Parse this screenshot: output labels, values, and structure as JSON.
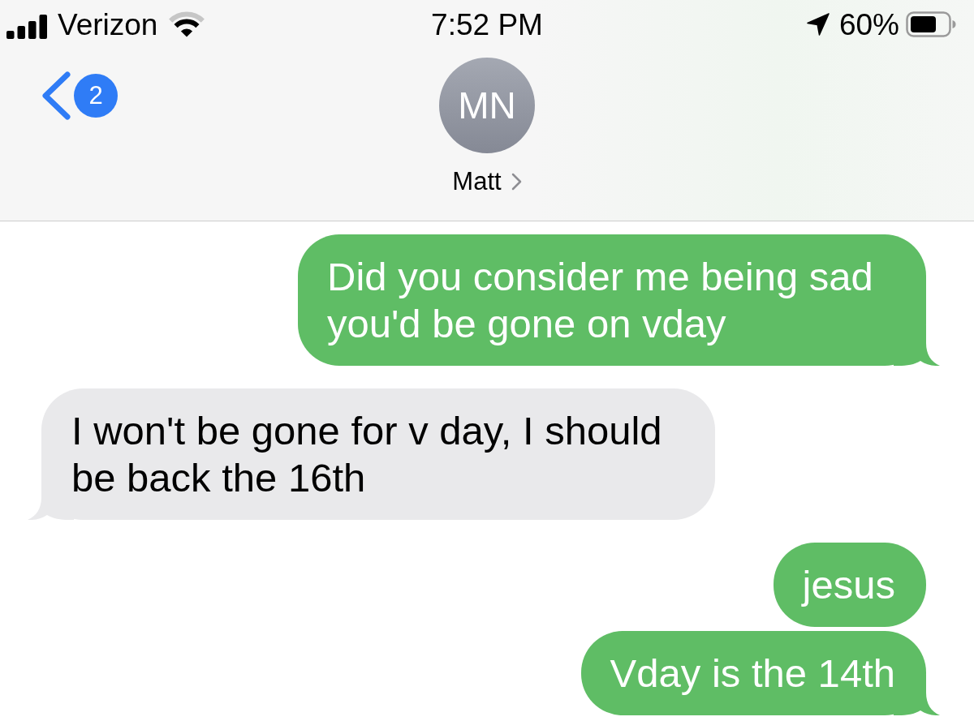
{
  "status_bar": {
    "carrier": "Verizon",
    "time": "7:52 PM",
    "battery_percent": "60%"
  },
  "navigation": {
    "back_badge": "2",
    "contact": {
      "initials": "MN",
      "name": "Matt"
    }
  },
  "messages": [
    {
      "kind": "sent",
      "text": "Did you consider me being sad you'd be gone on vday",
      "tail": true
    },
    {
      "kind": "received",
      "text": "I won't be gone for v day, I should be back the 16th",
      "tail": true
    },
    {
      "kind": "sent",
      "text": "jesus",
      "tail": false
    },
    {
      "kind": "sent",
      "text": "Vday is the 14th",
      "tail": true
    }
  ]
}
